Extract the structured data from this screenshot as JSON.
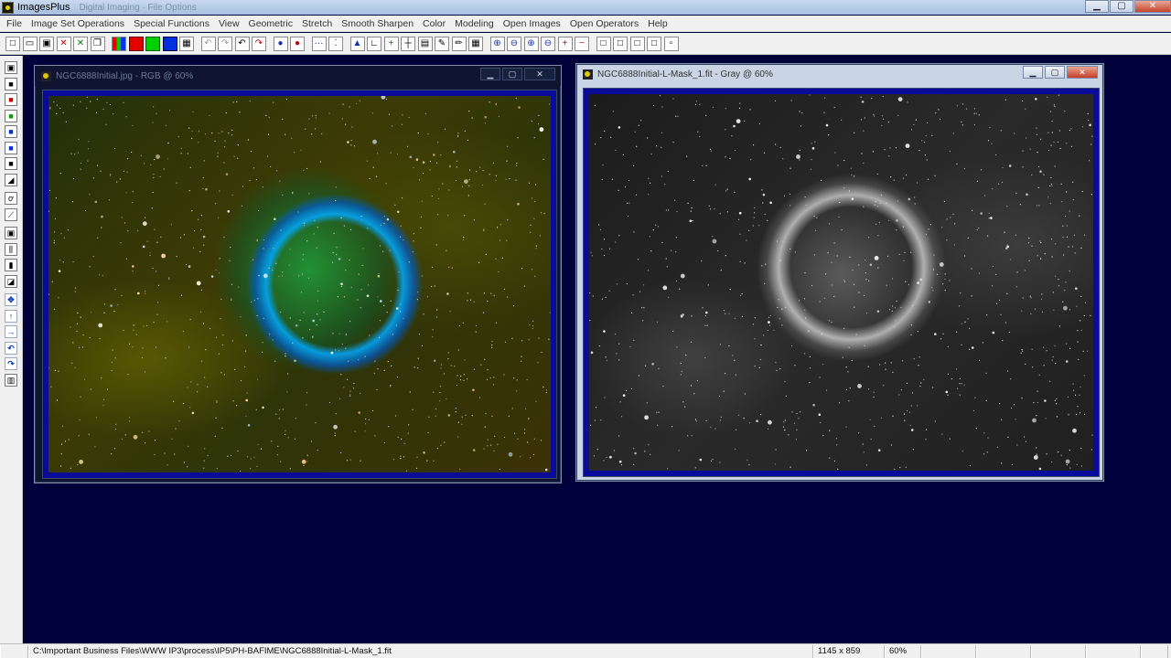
{
  "app": {
    "title": "ImagesPlus",
    "ghost_text": "Digital Imaging · File Options",
    "window_controls": {
      "minimize": "▁",
      "maximize": "▢",
      "close": "✕"
    }
  },
  "menu": [
    "File",
    "Image Set Operations",
    "Special Functions",
    "View",
    "Geometric",
    "Stretch",
    "Smooth Sharpen",
    "Color",
    "Modeling",
    "Open Images",
    "Open Operators",
    "Help"
  ],
  "toolbar": [
    {
      "icon": "new-file-icon",
      "glyph": "□"
    },
    {
      "icon": "open-folder-icon",
      "glyph": "▭"
    },
    {
      "icon": "save-icon",
      "glyph": "▣"
    },
    {
      "icon": "close-red-icon",
      "glyph": "✕"
    },
    {
      "icon": "close-green-icon",
      "glyph": "✕"
    },
    {
      "icon": "copy-icon",
      "glyph": "❐"
    },
    {
      "icon": "rgb-channels-icon",
      "glyph": ""
    },
    {
      "icon": "red-channel-icon",
      "glyph": ""
    },
    {
      "icon": "green-channel-icon",
      "glyph": ""
    },
    {
      "icon": "blue-channel-icon",
      "glyph": ""
    },
    {
      "icon": "grid-icon",
      "glyph": "▦"
    },
    {
      "icon": "undo-gray-icon",
      "glyph": "↶"
    },
    {
      "icon": "redo-gray-icon",
      "glyph": "↷"
    },
    {
      "icon": "undo-icon",
      "glyph": "↶"
    },
    {
      "icon": "redo-icon",
      "glyph": "↷"
    },
    {
      "icon": "circle-blue-icon",
      "glyph": "●"
    },
    {
      "icon": "circle-red-icon",
      "glyph": "●"
    },
    {
      "icon": "dotted-line-icon",
      "glyph": "···"
    },
    {
      "icon": "points-icon",
      "glyph": "⁚"
    },
    {
      "icon": "triangle-icon",
      "glyph": "▲"
    },
    {
      "icon": "axis-icon",
      "glyph": "∟"
    },
    {
      "icon": "plus-green-icon",
      "glyph": "+"
    },
    {
      "icon": "crosshair-icon",
      "glyph": "┼"
    },
    {
      "icon": "calculator-icon",
      "glyph": "▤"
    },
    {
      "icon": "paint-icon",
      "glyph": "✎"
    },
    {
      "icon": "pencil-icon",
      "glyph": "✏"
    },
    {
      "icon": "table-icon",
      "glyph": "▦"
    },
    {
      "icon": "zoom-in-icon",
      "glyph": "⊕"
    },
    {
      "icon": "zoom-out-icon",
      "glyph": "⊖"
    },
    {
      "icon": "zoom-fit-icon",
      "glyph": "⊕"
    },
    {
      "icon": "zoom-actual-icon",
      "glyph": "⊖"
    },
    {
      "icon": "add-red-icon",
      "glyph": "+"
    },
    {
      "icon": "remove-red-icon",
      "glyph": "−"
    },
    {
      "icon": "square-1-icon",
      "glyph": "□"
    },
    {
      "icon": "square-2-icon",
      "glyph": "□"
    },
    {
      "icon": "square-3-icon",
      "glyph": "□"
    },
    {
      "icon": "square-4-icon",
      "glyph": "□"
    },
    {
      "icon": "square-5-icon",
      "glyph": "▫"
    }
  ],
  "left_tools": [
    {
      "icon": "save-icon",
      "glyph": "▣"
    },
    {
      "icon": "black-square-icon",
      "glyph": "■"
    },
    {
      "icon": "red-black-icon",
      "glyph": "■"
    },
    {
      "icon": "green-black-icon",
      "glyph": "■"
    },
    {
      "icon": "blue-black-icon",
      "glyph": "■"
    },
    {
      "icon": "blue-square-icon",
      "glyph": "■"
    },
    {
      "icon": "dark-square-icon",
      "glyph": "■"
    },
    {
      "icon": "corner-icon",
      "glyph": "◢"
    },
    {
      "icon": "brush-icon",
      "glyph": "ơ"
    },
    {
      "icon": "line-icon",
      "glyph": "⟋"
    },
    {
      "icon": "frame-icon",
      "glyph": "▣"
    },
    {
      "icon": "levels-icon",
      "glyph": "⫼"
    },
    {
      "icon": "bar-icon",
      "glyph": "▮"
    },
    {
      "icon": "select-icon",
      "glyph": "◪"
    },
    {
      "icon": "move-icon",
      "glyph": "✥"
    },
    {
      "icon": "arrow-up-icon",
      "glyph": "↑"
    },
    {
      "icon": "arrow-right-icon",
      "glyph": "→"
    },
    {
      "icon": "rotate-left-icon",
      "glyph": "↶"
    },
    {
      "icon": "rotate-right-icon",
      "glyph": "↷"
    },
    {
      "icon": "info-icon",
      "glyph": "▥"
    }
  ],
  "windows": [
    {
      "title": "NGC6888Initial.jpg - RGB @ 60%",
      "kind": "color"
    },
    {
      "title": "NGC6888Initial-L-Mask_1.fit - Gray @ 60%",
      "kind": "gray"
    }
  ],
  "status": {
    "path": "C:\\Important Business Files\\WWW IP3\\process\\IP5\\PH-BAFIME\\NGC6888Initial-L-Mask_1.fit",
    "dimensions": "1145 x 859",
    "zoom": "60%"
  }
}
